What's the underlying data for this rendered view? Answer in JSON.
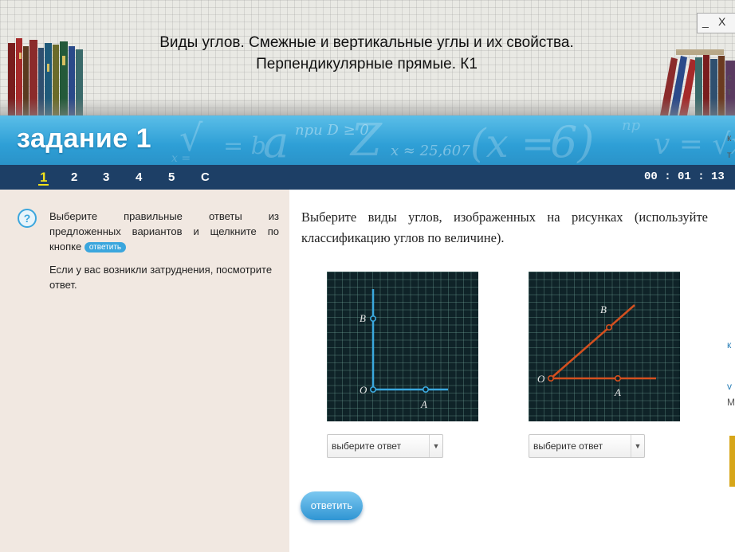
{
  "window": {
    "title": "Виды углов. Смежные и вертикальные углы и их свойства. Перпендикулярные прямые. К1",
    "minimize": "_",
    "close": "X"
  },
  "banner": {
    "title": "задание 1",
    "formulas": [
      "при D ≥ 0",
      "x ≈ 25,607",
      "при"
    ]
  },
  "nav": {
    "items": [
      "1",
      "2",
      "3",
      "4",
      "5",
      "C"
    ],
    "active_index": 0,
    "timer": "00 : 01 : 13"
  },
  "instructions": {
    "text": "Выберите правильные ответы из предложенных вариантов и щелкните по кнопке",
    "inline_button": "ответить",
    "hint": "Если у вас возникли затруднения, посмотрите ответ."
  },
  "question": {
    "text": "Выберите виды углов, изображенных на рисунках (используйте классификацию углов по величине)."
  },
  "figures": [
    {
      "labels": {
        "vertex": "O",
        "ray1": "B",
        "ray2": "A"
      },
      "angle_degrees": 90,
      "color": "#3aa8de"
    },
    {
      "labels": {
        "vertex": "O",
        "ray1": "B",
        "ray2": "A"
      },
      "angle_degrees": 35,
      "color": "#d4501f"
    }
  ],
  "selects": [
    {
      "value": "выберите ответ",
      "arrow": "▼"
    },
    {
      "value": "выберите ответ",
      "arrow": "▼"
    }
  ],
  "answer_button": "ответить",
  "edge_fragments": [
    "с",
    "т",
    "к",
    "т",
    "к",
    "v",
    "М"
  ],
  "colors": {
    "banner_blue": "#2e9fd6",
    "nav_navy": "#1d3f66",
    "active_yellow": "#f2e21b",
    "panel_beige": "#f1e8e1",
    "figure_bg": "#0f2328",
    "button_blue": "#3ba6dd"
  }
}
